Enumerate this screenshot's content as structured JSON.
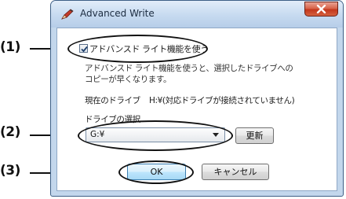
{
  "window": {
    "title": "Advanced Write",
    "icon": "pen-icon",
    "close_icon": "close-x-icon"
  },
  "dialog": {
    "checkbox_label": "アドバンスド ライト機能を使う",
    "checkbox_checked": true,
    "description_line1": "アドバンスド ライト機能を使うと、選択したドライブへの",
    "description_line2": "コピーが早くなります。",
    "current_drive_label": "現在のドライブ",
    "current_drive_value": "H:¥(対応ドライブが接続されていません)",
    "drive_select_label": "ドライブの選択",
    "drive_select_value": "G:¥",
    "refresh_button": "更新",
    "ok_button": "OK",
    "cancel_button": "キャンセル"
  },
  "callouts": [
    "(1)",
    "(2)",
    "(3)"
  ],
  "colors": {
    "titlebar": "#c6daf0",
    "close_button": "#c3371d",
    "ok_button_focus": "#3c7fb1",
    "frame": "#3e5f86"
  }
}
